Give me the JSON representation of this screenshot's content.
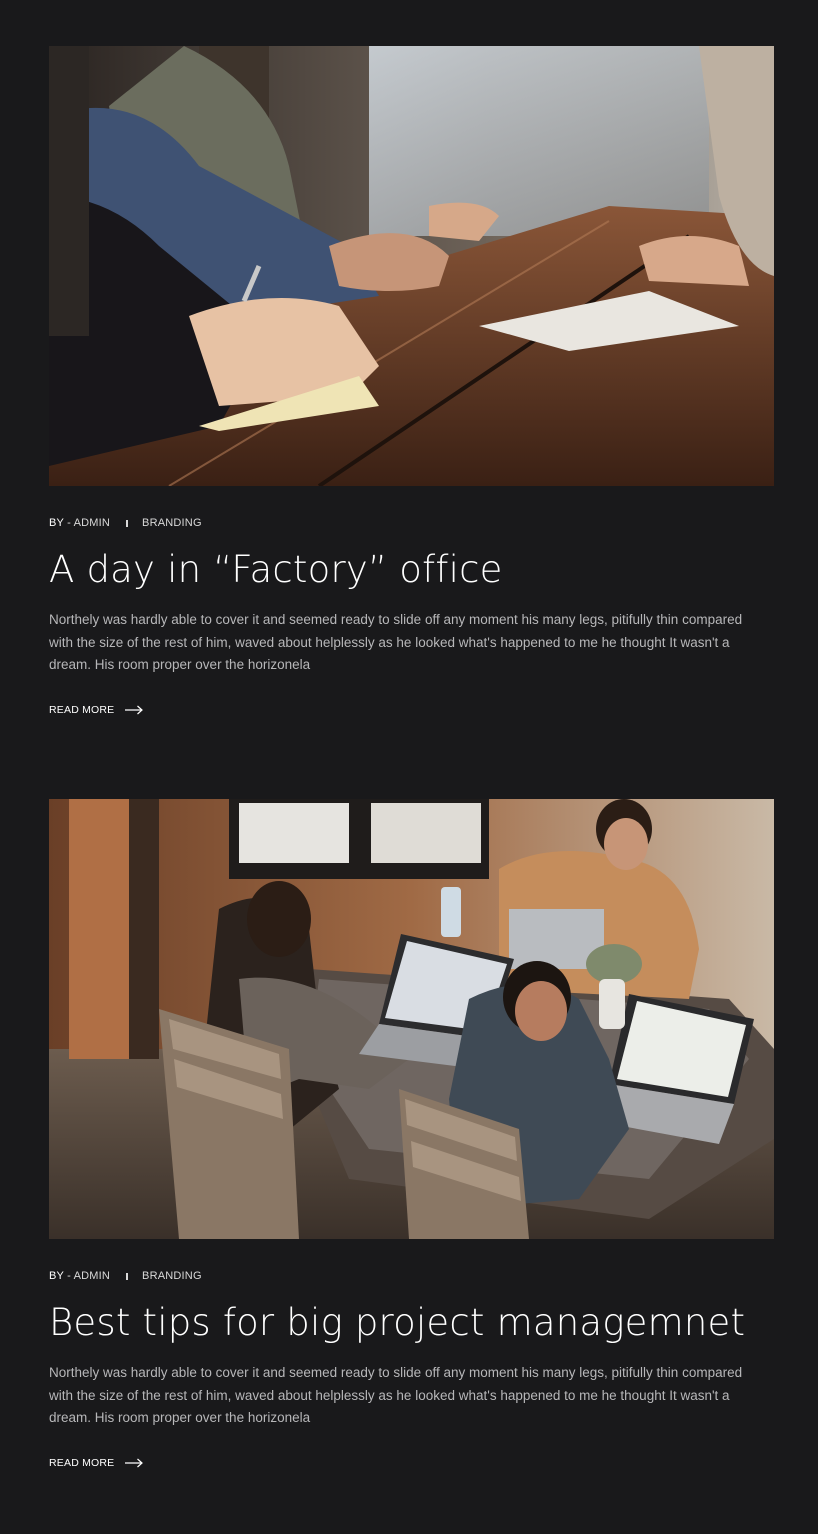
{
  "posts": [
    {
      "meta": {
        "by_label": "BY",
        "author": "- ADMIN",
        "category": "BRANDING"
      },
      "title": "A day in “Factory” office",
      "excerpt": "Northely was hardly able to cover it and seemed ready to slide off any moment his many legs, pitifully thin compared with the size of the rest of him, waved about helplessly as he looked what's happened to me he thought It wasn't a dream. His room proper over the horizonela",
      "read_more": "READ MORE",
      "image_icon": "meeting-photo"
    },
    {
      "meta": {
        "by_label": "BY",
        "author": "- ADMIN",
        "category": "BRANDING"
      },
      "title": "Best tips for big project managemnet",
      "excerpt": "Northely was hardly able to cover it and seemed ready to slide off any moment his many legs, pitifully thin compared with the size of the rest of him, waved about helplessly as he looked what's happened to me he thought It wasn't a dream. His room proper over the horizonela",
      "read_more": "READ MORE",
      "image_icon": "team-laptops-photo"
    }
  ],
  "colors": {
    "background": "#19191b",
    "text": "#ffffff",
    "muted_text": "#b7b7b9"
  }
}
